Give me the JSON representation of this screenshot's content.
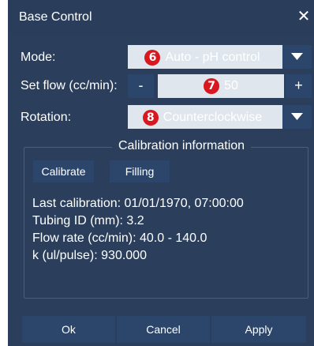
{
  "dialog": {
    "title": "Base Control",
    "close_glyph": "✕"
  },
  "mode": {
    "label": "Mode:",
    "badge": "6",
    "value": "Auto - pH control"
  },
  "flow": {
    "label": "Set flow (cc/min):",
    "minus": "-",
    "badge": "7",
    "value": "50",
    "plus": "+"
  },
  "rotation": {
    "label": "Rotation:",
    "badge": "8",
    "value": "Counterclockwise"
  },
  "calibration": {
    "title": "Calibration information",
    "calibrate_label": "Calibrate",
    "filling_label": "Filling",
    "last_calibration": "Last calibration: 01/01/1970, 07:00:00",
    "tubing_id": "Tubing ID (mm): 3.2",
    "flow_rate": "Flow rate (cc/min): 40.0 - 140.0",
    "k_value": "k (ul/pulse): 930.000"
  },
  "footer": {
    "ok_label": "Ok",
    "cancel_label": "Cancel",
    "apply_label": "Apply"
  },
  "icons": {
    "close": "close-icon",
    "dropdown": "chevron-down-icon"
  },
  "colors": {
    "dialog_bg": "#2b3f5c",
    "button_bg": "#2c466b",
    "field_bg": "#dfe6ed",
    "badge_red": "#d8181e"
  }
}
